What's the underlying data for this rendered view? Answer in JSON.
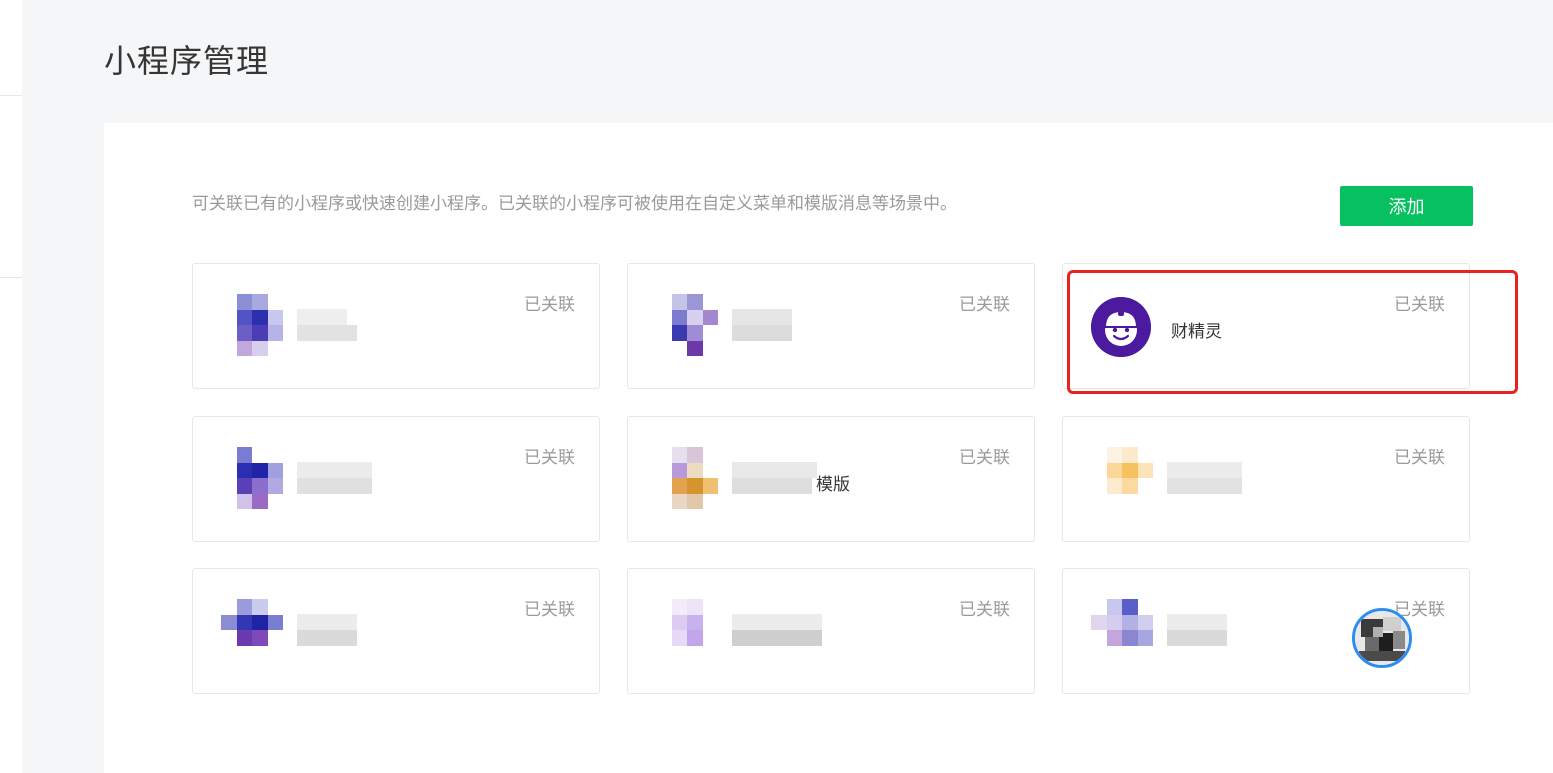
{
  "page": {
    "title": "小程序管理"
  },
  "panel": {
    "description": "可关联已有的小程序或快速创建小程序。已关联的小程序可被使用在自定义菜单和模版消息等场景中。",
    "add_button": "添加"
  },
  "cards": [
    {
      "status": "已关联",
      "name": ""
    },
    {
      "status": "已关联",
      "name": ""
    },
    {
      "status": "已关联",
      "name": "财精灵"
    },
    {
      "status": "已关联",
      "name": ""
    },
    {
      "status": "已关联",
      "name": "模版"
    },
    {
      "status": "已关联",
      "name": ""
    },
    {
      "status": "已关联",
      "name": ""
    },
    {
      "status": "已关联",
      "name": ""
    },
    {
      "status": "已关联",
      "name": ""
    }
  ],
  "colors": {
    "accent_green": "#07c160",
    "highlight_red": "#e8231f",
    "avatar_purple": "#4b1a9e",
    "muted_text": "#9a9a9a"
  },
  "icons": {
    "highlighted_avatar": "robot-face-icon",
    "floating_profile": "user-photo-avatar"
  }
}
